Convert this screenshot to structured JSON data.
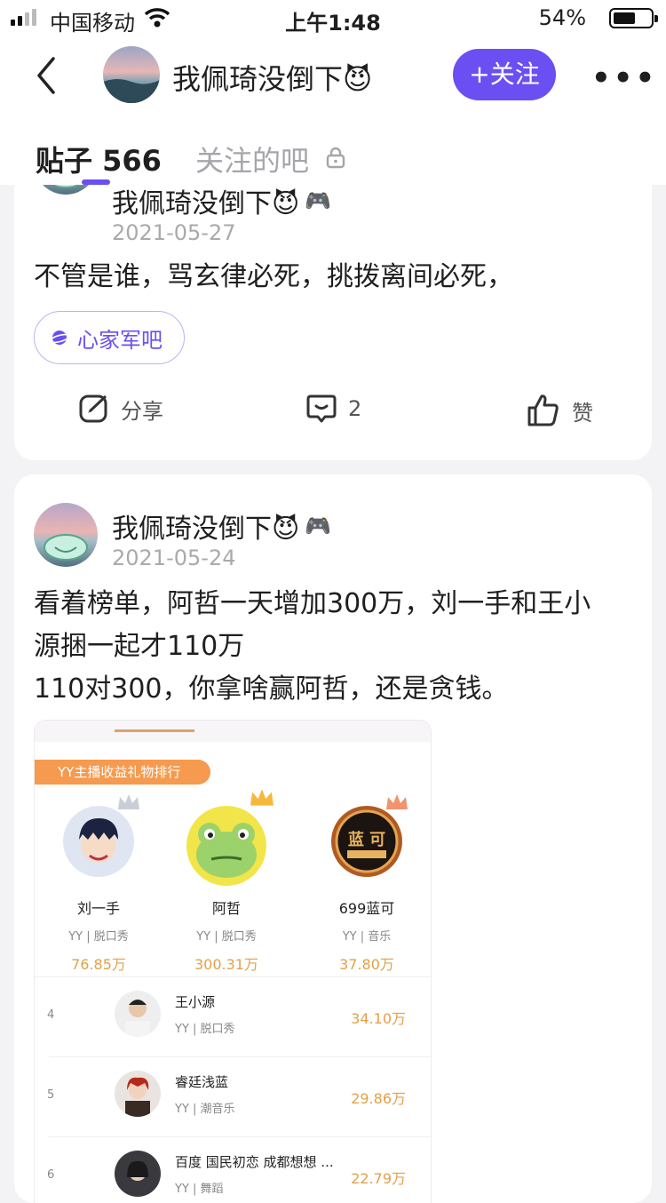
{
  "status": {
    "carrier": "中国移动",
    "time": "上午1:48",
    "battery": "54%"
  },
  "header": {
    "username": "我佩琦没倒下😈",
    "follow_label": "+关注"
  },
  "tabs": [
    {
      "label": "贴子 566"
    },
    {
      "label": "关注的吧"
    }
  ],
  "posts": [
    {
      "author": "我佩琦没倒下😈",
      "date": "2021-05-27",
      "text": "不管是谁，骂玄律必死，挑拨离间必死，",
      "forum": "心家军吧",
      "actions": {
        "share": "分享",
        "comments": "2",
        "like": "赞"
      }
    },
    {
      "author": "我佩琦没倒下😈",
      "date": "2021-05-24",
      "text": "看着榜单，阿哲一天增加300万，刘一手和王小\n源捆一起才110万\n110对300，你拿啥赢阿哲，还是贪钱。",
      "image": {
        "banner": "YY主播收益礼物排行",
        "podium": [
          {
            "name": "刘一手",
            "category": "YY | 脱口秀",
            "value": "76.85万"
          },
          {
            "name": "阿哲",
            "category": "YY | 脱口秀",
            "value": "300.31万"
          },
          {
            "name": "699蓝可",
            "category": "YY | 音乐",
            "value": "37.80万"
          }
        ],
        "rows": [
          {
            "rank": "4",
            "name": "王小源",
            "category": "YY | 脱口秀",
            "value": "34.10万"
          },
          {
            "rank": "5",
            "name": "睿廷浅蓝",
            "category": "YY | 潮音乐",
            "value": "29.86万"
          },
          {
            "rank": "6",
            "name": "百度 国民初恋 成都想想 ...",
            "category": "YY | 舞蹈",
            "value": "22.79万"
          }
        ]
      }
    }
  ]
}
